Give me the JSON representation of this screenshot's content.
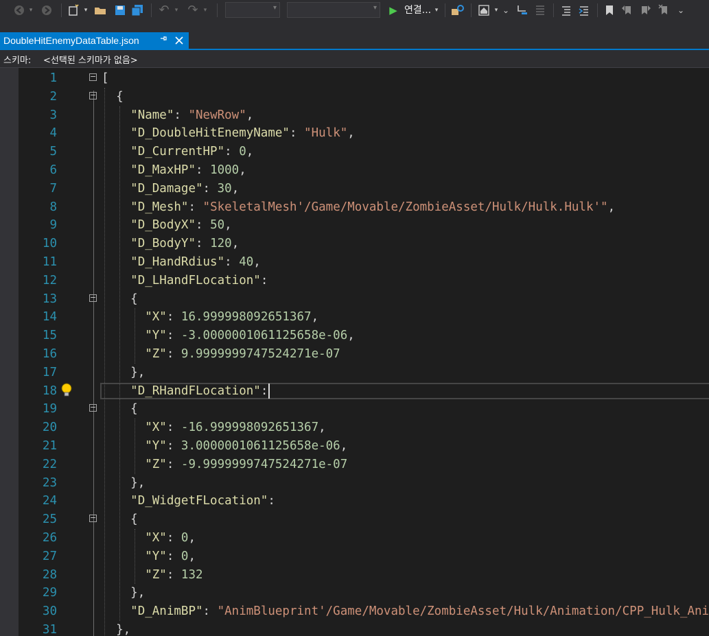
{
  "toolbar": {
    "run_label": "연결..."
  },
  "tab": {
    "title": "DoubleHitEnemyDataTable.json",
    "pin_icon": "📌",
    "close_icon": "✕"
  },
  "schema": {
    "label": "스키마:",
    "value": "<선택된 스키마가 없음>"
  },
  "editor": {
    "lines": [
      {
        "n": "1",
        "text": "["
      },
      {
        "n": "2",
        "text": "  {"
      },
      {
        "n": "3",
        "text": "    \"Name\": \"NewRow\","
      },
      {
        "n": "4",
        "text": "    \"D_DoubleHitEnemyName\": \"Hulk\","
      },
      {
        "n": "5",
        "text": "    \"D_CurrentHP\": 0,"
      },
      {
        "n": "6",
        "text": "    \"D_MaxHP\": 1000,"
      },
      {
        "n": "7",
        "text": "    \"D_Damage\": 30,"
      },
      {
        "n": "8",
        "text": "    \"D_Mesh\": \"SkeletalMesh'/Game/Movable/ZombieAsset/Hulk/Hulk.Hulk'\","
      },
      {
        "n": "9",
        "text": "    \"D_BodyX\": 50,"
      },
      {
        "n": "10",
        "text": "    \"D_BodyY\": 120,"
      },
      {
        "n": "11",
        "text": "    \"D_HandRdius\": 40,"
      },
      {
        "n": "12",
        "text": "    \"D_LHandFLocation\":"
      },
      {
        "n": "13",
        "text": "    {"
      },
      {
        "n": "14",
        "text": "      \"X\": 16.999998092651367,"
      },
      {
        "n": "15",
        "text": "      \"Y\": -3.0000001061125658e-06,"
      },
      {
        "n": "16",
        "text": "      \"Z\": 9.9999999747524271e-07"
      },
      {
        "n": "17",
        "text": "    },"
      },
      {
        "n": "18",
        "text": "    \"D_RHandFLocation\":"
      },
      {
        "n": "19",
        "text": "    {"
      },
      {
        "n": "20",
        "text": "      \"X\": -16.999998092651367,"
      },
      {
        "n": "21",
        "text": "      \"Y\": 3.0000001061125658e-06,"
      },
      {
        "n": "22",
        "text": "      \"Z\": -9.9999999747524271e-07"
      },
      {
        "n": "23",
        "text": "    },"
      },
      {
        "n": "24",
        "text": "    \"D_WidgetFLocation\":"
      },
      {
        "n": "25",
        "text": "    {"
      },
      {
        "n": "26",
        "text": "      \"X\": 0,"
      },
      {
        "n": "27",
        "text": "      \"Y\": 0,"
      },
      {
        "n": "28",
        "text": "      \"Z\": 132"
      },
      {
        "n": "29",
        "text": "    },"
      },
      {
        "n": "30",
        "text": "    \"D_AnimBP\": \"AnimBlueprint'/Game/Movable/ZombieAsset/Hulk/Animation/CPP_Hulk_AnimBP.CPP_Hulk_AnimBP_C'\","
      },
      {
        "n": "31",
        "text": "  },"
      }
    ],
    "fold_lines": [
      "1",
      "2",
      "13",
      "19",
      "25"
    ],
    "lightbulb_line": "18",
    "current_line": "18"
  }
}
